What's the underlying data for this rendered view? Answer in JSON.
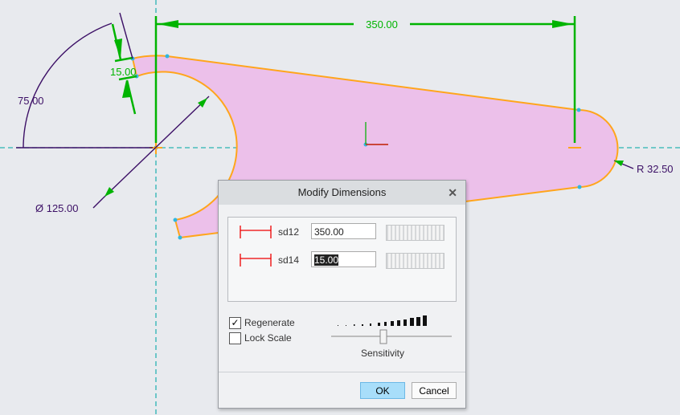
{
  "sketch": {
    "dimensions": {
      "width_top": "350.00",
      "thickness": "15.00",
      "angle": "75.00",
      "diameter": "Ø 125.00",
      "radius": "R 32.50"
    },
    "colors": {
      "fill": "#ecc0ea",
      "edge": "#ffa51c",
      "dim_strong": "#00b400",
      "dim_weak": "#3c1066",
      "centerline": "#2ab3b3"
    }
  },
  "dialog": {
    "title": "Modify Dimensions",
    "rows": [
      {
        "name": "sd12",
        "value": "350.00"
      },
      {
        "name": "sd14",
        "value": "15.00"
      }
    ],
    "regenerate_label": "Regenerate",
    "regenerate_checked": true,
    "lock_scale_label": "Lock Scale",
    "lock_scale_checked": false,
    "sensitivity_label": "Sensitivity",
    "ok_label": "OK",
    "cancel_label": "Cancel",
    "close_glyph": "✕"
  }
}
